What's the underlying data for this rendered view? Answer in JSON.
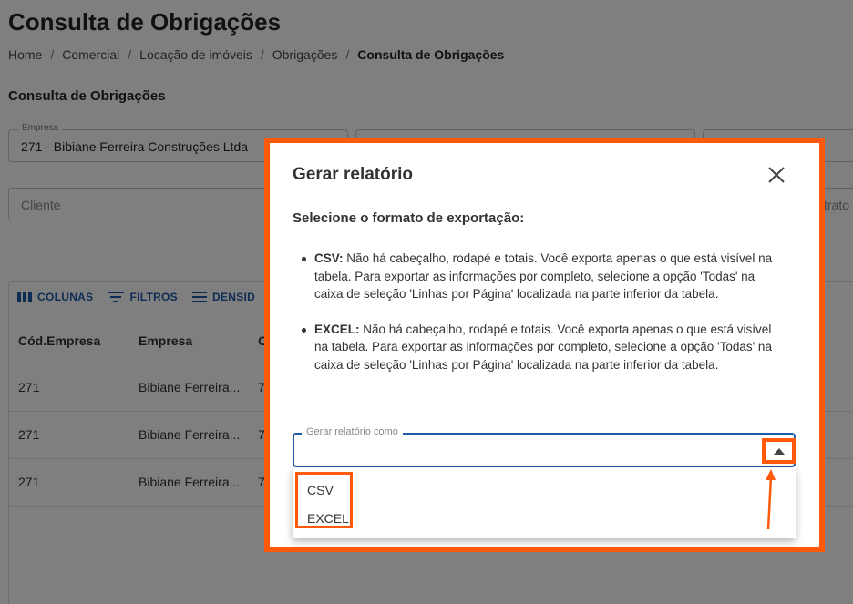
{
  "page": {
    "title": "Consulta de Obrigações",
    "breadcrumb": [
      "Home",
      "Comercial",
      "Locação de imóveis",
      "Obrigações",
      "Consulta de Obrigações"
    ],
    "section_title": "Consulta de Obrigações"
  },
  "filters": {
    "empresa_label": "Empresa",
    "empresa_value": "271 - Bibiane Ferreira Construções Ltda",
    "cliente_placeholder": "Cliente",
    "contrato_placeholder": "trato"
  },
  "table": {
    "toolbar": [
      "COLUNAS",
      "FILTROS",
      "DENSID"
    ],
    "headers": [
      "Cód.Empresa",
      "Empresa",
      "C"
    ],
    "rows": [
      [
        "271",
        "Bibiane Ferreira...",
        "7"
      ],
      [
        "271",
        "Bibiane Ferreira...",
        "7"
      ],
      [
        "271",
        "Bibiane Ferreira...",
        "7"
      ]
    ]
  },
  "modal": {
    "title": "Gerar relatório",
    "subtitle": "Selecione o formato de exportação:",
    "bullets": [
      {
        "label": "CSV:",
        "text": " Não há cabeçalho, rodapé e totais. Você exporta apenas o que está visível na tabela. Para exportar as informações por completo, selecione a opção 'Todas' na caixa de seleção 'Linhas por Página' localizada na parte inferior da tabela."
      },
      {
        "label": "EXCEL:",
        "text": " Não há cabeçalho, rodapé e totais. Você exporta apenas o que está visível na tabela. Para exportar as informações por completo, selecione a opção 'Todas' na caixa de seleção 'Linhas por Página' localizada na parte inferior da tabela."
      }
    ],
    "select_label": "Gerar relatório como",
    "options": [
      "CSV",
      "EXCEL"
    ]
  },
  "colors": {
    "accent": "#1e5aa8",
    "highlight": "#ff5a0a"
  }
}
